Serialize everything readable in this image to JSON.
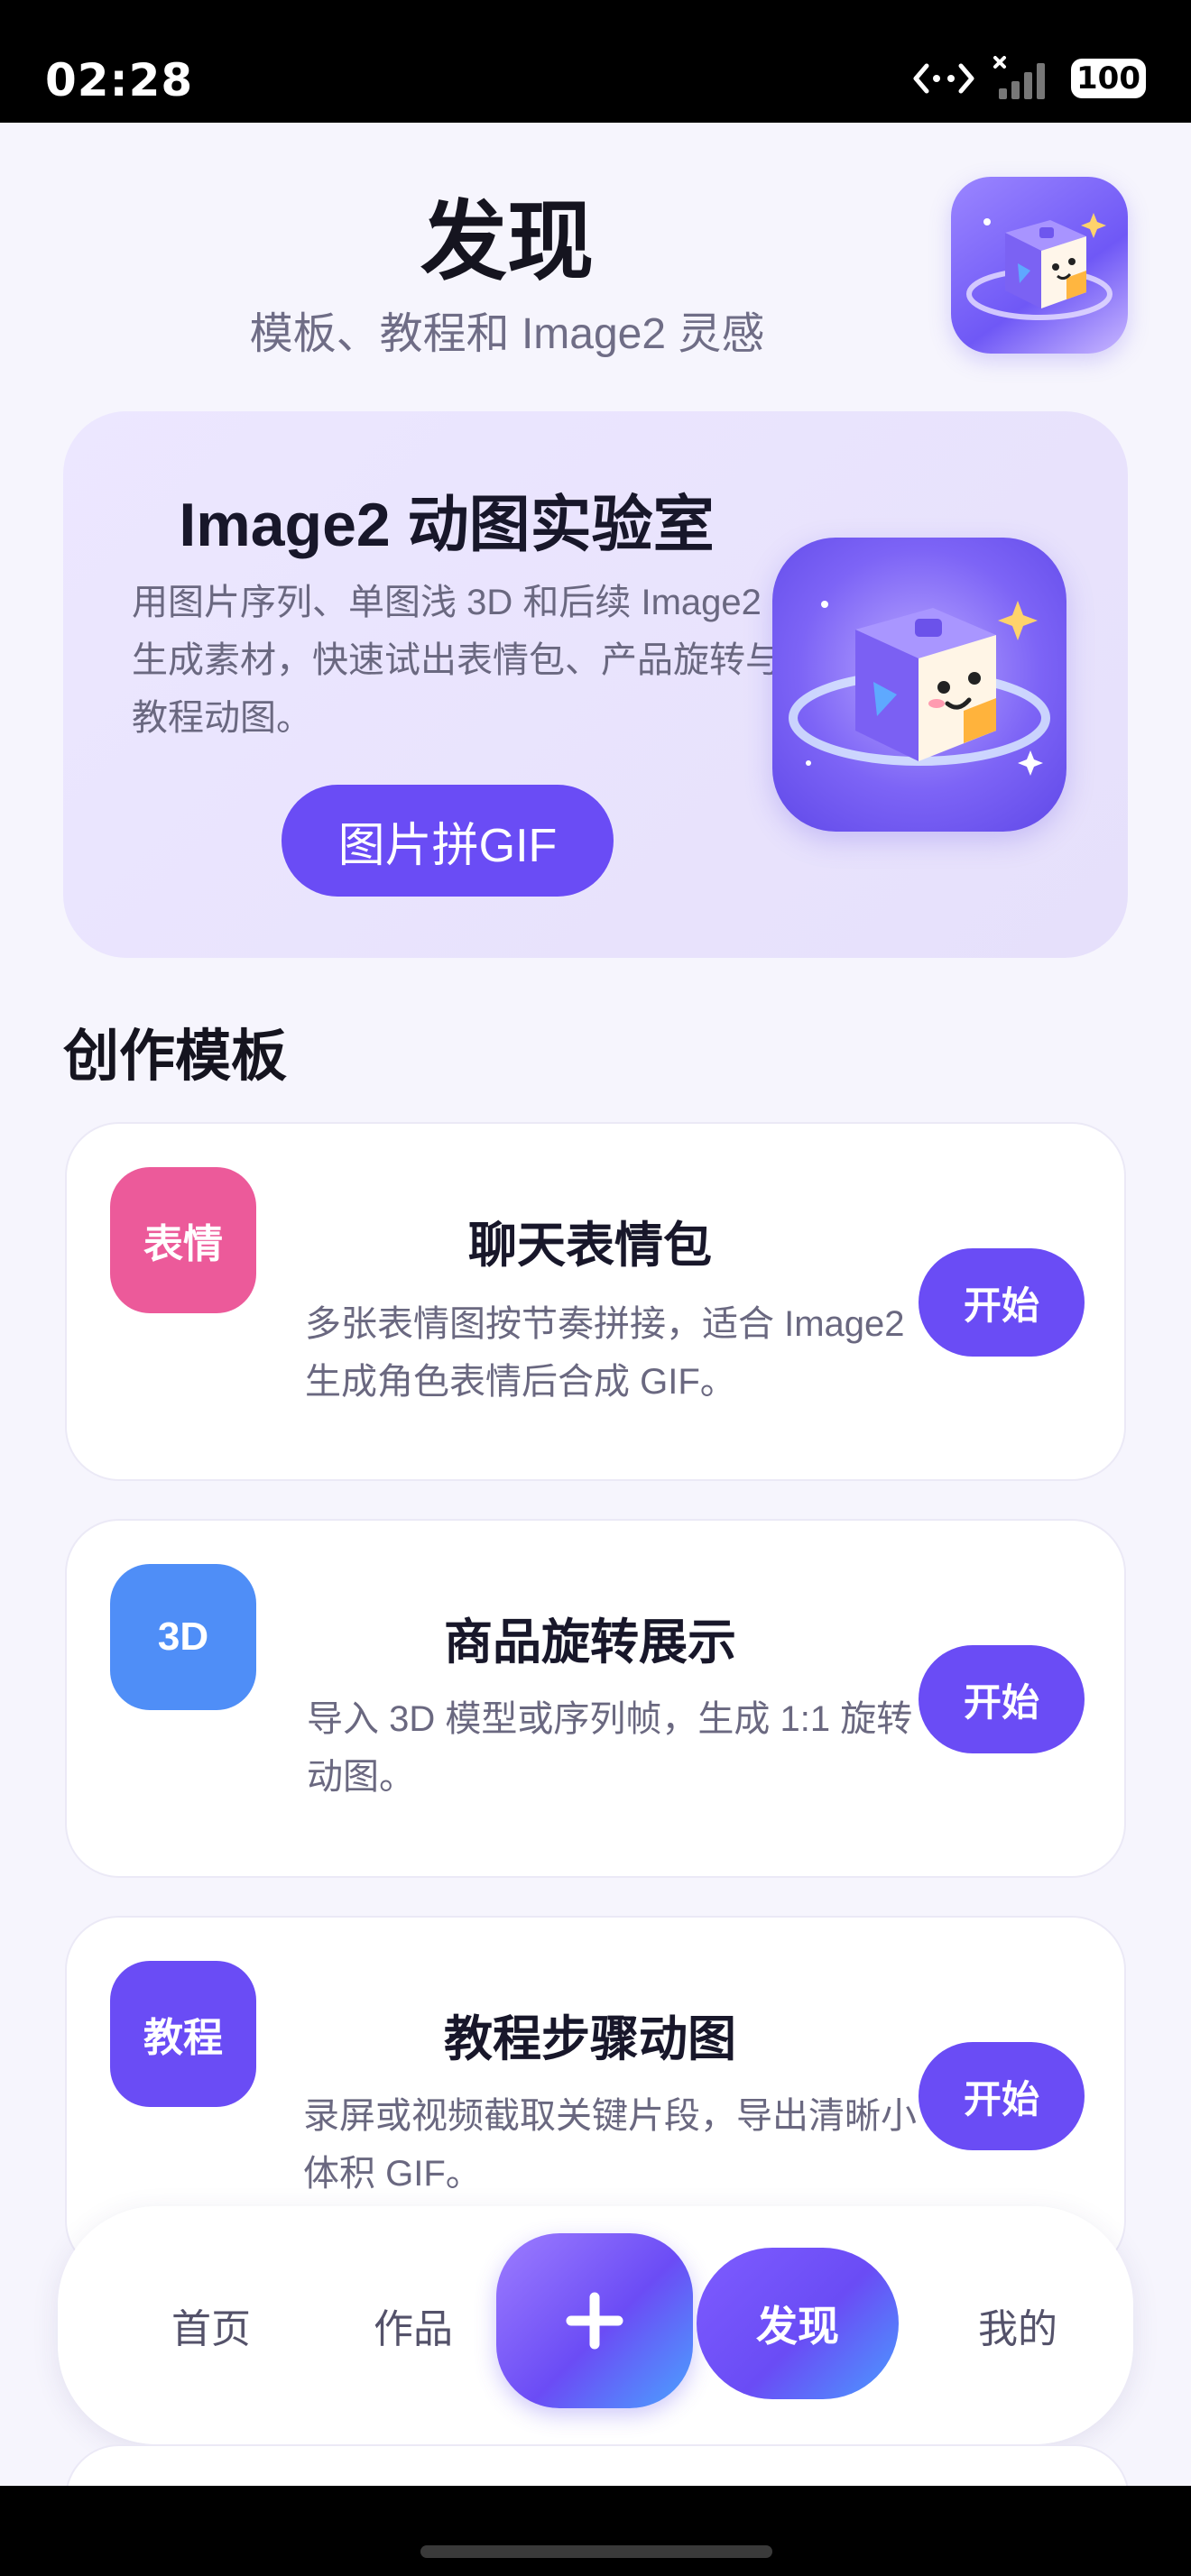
{
  "status_bar": {
    "time": "02:28",
    "battery": "100"
  },
  "header": {
    "title": "发现",
    "subtitle": "模板、教程和 Image2 灵感"
  },
  "hero": {
    "title": "Image2 动图实验室",
    "description": "用图片序列、单图浅 3D 和后续 Image2 生成素材，快速试出表情包、产品旋转与教程动图。",
    "button_label": "图片拼GIF"
  },
  "templates_section": {
    "title": "创作模板",
    "items": [
      {
        "badge": "表情",
        "badge_color": "#ec5a9a",
        "title": "聊天表情包",
        "description": "多张表情图按节奏拼接，适合 Image2 生成角色表情后合成 GIF。",
        "button_label": "开始"
      },
      {
        "badge": "3D",
        "badge_color": "#4f8ef7",
        "title": "商品旋转展示",
        "description": "导入 3D 模型或序列帧，生成 1:1 旋转动图。",
        "button_label": "开始"
      },
      {
        "badge": "教程",
        "badge_color": "#6a4cf5",
        "title": "教程步骤动图",
        "description": "录屏或视频截取关键片段，导出清晰小体积 GIF。",
        "button_label": "开始"
      }
    ]
  },
  "tab_bar": {
    "items": [
      "首页",
      "作品",
      "发现",
      "我的"
    ],
    "active": "发现",
    "add_icon": "plus-icon"
  },
  "colors": {
    "accent": "#6a4cf5",
    "background": "#f6f5fd"
  }
}
